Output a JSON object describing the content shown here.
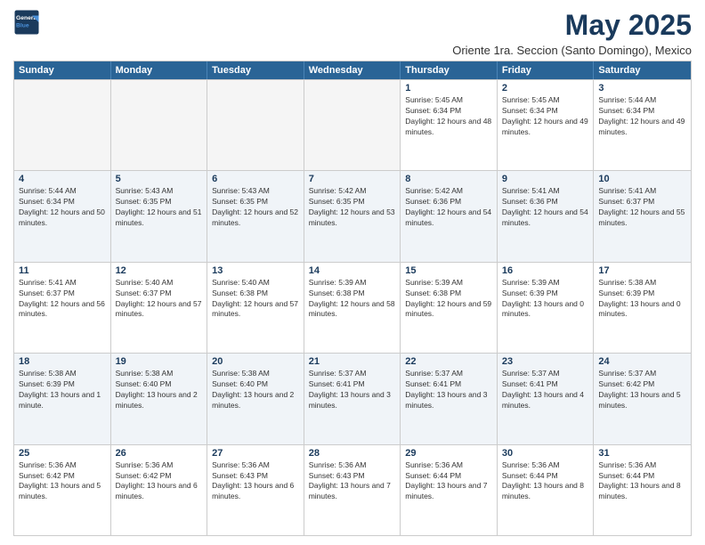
{
  "logo": {
    "line1": "General",
    "line2": "Blue"
  },
  "title": "May 2025",
  "subtitle": "Oriente 1ra. Seccion (Santo Domingo), Mexico",
  "header": {
    "days": [
      "Sunday",
      "Monday",
      "Tuesday",
      "Wednesday",
      "Thursday",
      "Friday",
      "Saturday"
    ]
  },
  "weeks": [
    [
      {
        "day": "",
        "empty": true
      },
      {
        "day": "",
        "empty": true
      },
      {
        "day": "",
        "empty": true
      },
      {
        "day": "",
        "empty": true
      },
      {
        "day": "1",
        "sunrise": "5:45 AM",
        "sunset": "6:34 PM",
        "daylight": "12 hours and 48 minutes."
      },
      {
        "day": "2",
        "sunrise": "5:45 AM",
        "sunset": "6:34 PM",
        "daylight": "12 hours and 49 minutes."
      },
      {
        "day": "3",
        "sunrise": "5:44 AM",
        "sunset": "6:34 PM",
        "daylight": "12 hours and 49 minutes."
      }
    ],
    [
      {
        "day": "4",
        "sunrise": "5:44 AM",
        "sunset": "6:34 PM",
        "daylight": "12 hours and 50 minutes."
      },
      {
        "day": "5",
        "sunrise": "5:43 AM",
        "sunset": "6:35 PM",
        "daylight": "12 hours and 51 minutes."
      },
      {
        "day": "6",
        "sunrise": "5:43 AM",
        "sunset": "6:35 PM",
        "daylight": "12 hours and 52 minutes."
      },
      {
        "day": "7",
        "sunrise": "5:42 AM",
        "sunset": "6:35 PM",
        "daylight": "12 hours and 53 minutes."
      },
      {
        "day": "8",
        "sunrise": "5:42 AM",
        "sunset": "6:36 PM",
        "daylight": "12 hours and 54 minutes."
      },
      {
        "day": "9",
        "sunrise": "5:41 AM",
        "sunset": "6:36 PM",
        "daylight": "12 hours and 54 minutes."
      },
      {
        "day": "10",
        "sunrise": "5:41 AM",
        "sunset": "6:37 PM",
        "daylight": "12 hours and 55 minutes."
      }
    ],
    [
      {
        "day": "11",
        "sunrise": "5:41 AM",
        "sunset": "6:37 PM",
        "daylight": "12 hours and 56 minutes."
      },
      {
        "day": "12",
        "sunrise": "5:40 AM",
        "sunset": "6:37 PM",
        "daylight": "12 hours and 57 minutes."
      },
      {
        "day": "13",
        "sunrise": "5:40 AM",
        "sunset": "6:38 PM",
        "daylight": "12 hours and 57 minutes."
      },
      {
        "day": "14",
        "sunrise": "5:39 AM",
        "sunset": "6:38 PM",
        "daylight": "12 hours and 58 minutes."
      },
      {
        "day": "15",
        "sunrise": "5:39 AM",
        "sunset": "6:38 PM",
        "daylight": "12 hours and 59 minutes."
      },
      {
        "day": "16",
        "sunrise": "5:39 AM",
        "sunset": "6:39 PM",
        "daylight": "13 hours and 0 minutes."
      },
      {
        "day": "17",
        "sunrise": "5:38 AM",
        "sunset": "6:39 PM",
        "daylight": "13 hours and 0 minutes."
      }
    ],
    [
      {
        "day": "18",
        "sunrise": "5:38 AM",
        "sunset": "6:39 PM",
        "daylight": "13 hours and 1 minute."
      },
      {
        "day": "19",
        "sunrise": "5:38 AM",
        "sunset": "6:40 PM",
        "daylight": "13 hours and 2 minutes."
      },
      {
        "day": "20",
        "sunrise": "5:38 AM",
        "sunset": "6:40 PM",
        "daylight": "13 hours and 2 minutes."
      },
      {
        "day": "21",
        "sunrise": "5:37 AM",
        "sunset": "6:41 PM",
        "daylight": "13 hours and 3 minutes."
      },
      {
        "day": "22",
        "sunrise": "5:37 AM",
        "sunset": "6:41 PM",
        "daylight": "13 hours and 3 minutes."
      },
      {
        "day": "23",
        "sunrise": "5:37 AM",
        "sunset": "6:41 PM",
        "daylight": "13 hours and 4 minutes."
      },
      {
        "day": "24",
        "sunrise": "5:37 AM",
        "sunset": "6:42 PM",
        "daylight": "13 hours and 5 minutes."
      }
    ],
    [
      {
        "day": "25",
        "sunrise": "5:36 AM",
        "sunset": "6:42 PM",
        "daylight": "13 hours and 5 minutes."
      },
      {
        "day": "26",
        "sunrise": "5:36 AM",
        "sunset": "6:42 PM",
        "daylight": "13 hours and 6 minutes."
      },
      {
        "day": "27",
        "sunrise": "5:36 AM",
        "sunset": "6:43 PM",
        "daylight": "13 hours and 6 minutes."
      },
      {
        "day": "28",
        "sunrise": "5:36 AM",
        "sunset": "6:43 PM",
        "daylight": "13 hours and 7 minutes."
      },
      {
        "day": "29",
        "sunrise": "5:36 AM",
        "sunset": "6:44 PM",
        "daylight": "13 hours and 7 minutes."
      },
      {
        "day": "30",
        "sunrise": "5:36 AM",
        "sunset": "6:44 PM",
        "daylight": "13 hours and 8 minutes."
      },
      {
        "day": "31",
        "sunrise": "5:36 AM",
        "sunset": "6:44 PM",
        "daylight": "13 hours and 8 minutes."
      }
    ]
  ],
  "labels": {
    "sunrise": "Sunrise:",
    "sunset": "Sunset:",
    "daylight": "Daylight:"
  }
}
